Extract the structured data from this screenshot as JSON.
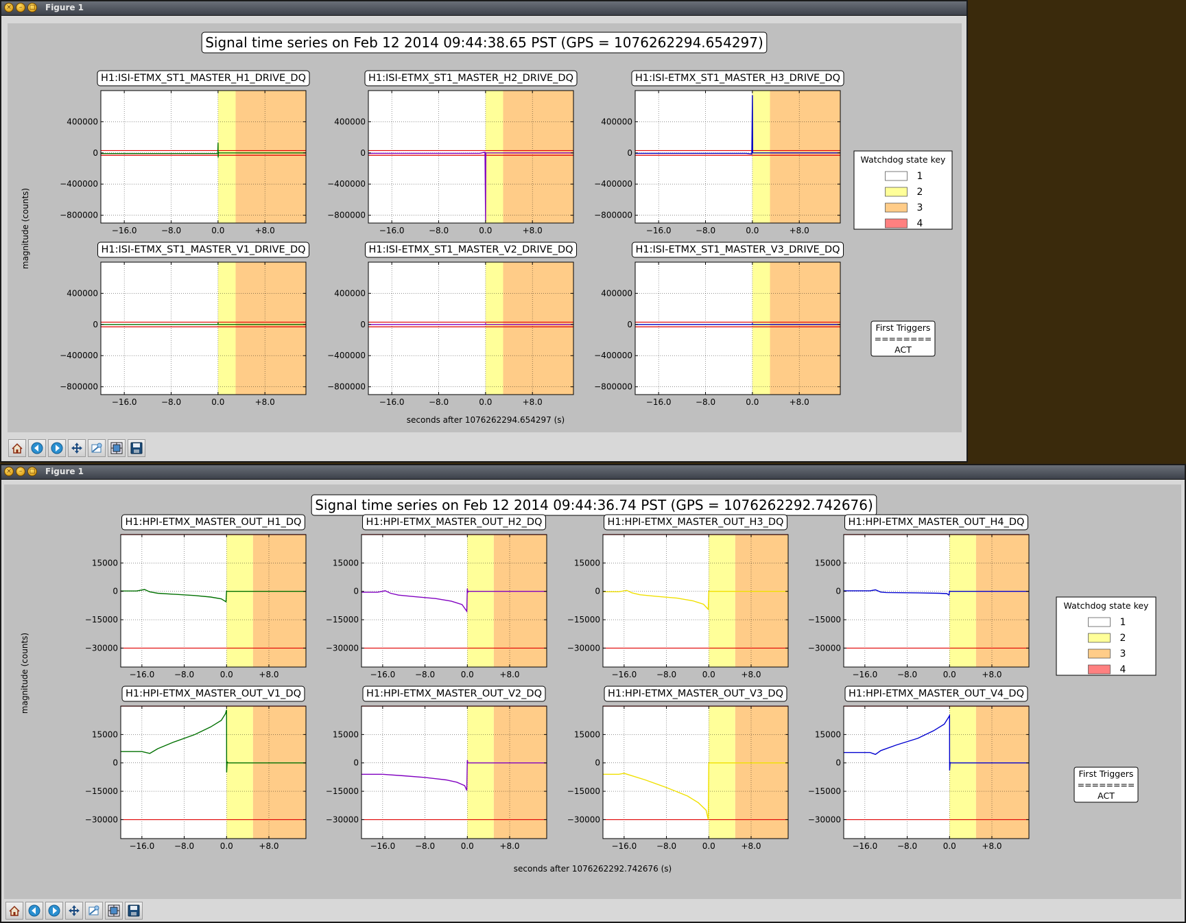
{
  "windows": [
    {
      "title": "Figure 1",
      "figure": {
        "title": "Signal time series on Feb 12 2014 09:44:38.65 PST (GPS = 1076262294.654297)",
        "xlabel": "seconds after 1076262294.654297 (s)",
        "ylabel": "magnitude (counts)",
        "legend": {
          "title": "Watchdog state key",
          "entries": [
            {
              "label": "1",
              "color": "#ffffff"
            },
            {
              "label": "2",
              "color": "#ffff99"
            },
            {
              "label": "3",
              "color": "#ffcc88"
            },
            {
              "label": "4",
              "color": "#ff8080"
            }
          ]
        },
        "triggers": {
          "header": "First Triggers",
          "rule": "========",
          "value": "ACT"
        }
      }
    },
    {
      "title": "Figure 1",
      "figure": {
        "title": "Signal time series on Feb 12 2014 09:44:36.74 PST (GPS = 1076262292.742676)",
        "xlabel": "seconds after 1076262292.742676 (s)",
        "ylabel": "magnitude (counts)",
        "legend": {
          "title": "Watchdog state key",
          "entries": [
            {
              "label": "1",
              "color": "#ffffff"
            },
            {
              "label": "2",
              "color": "#ffff99"
            },
            {
              "label": "3",
              "color": "#ffcc88"
            },
            {
              "label": "4",
              "color": "#ff8080"
            }
          ]
        },
        "triggers": {
          "header": "First Triggers",
          "rule": "========",
          "value": "ACT"
        }
      }
    }
  ],
  "toolbar_icons": [
    "home-icon",
    "back-icon",
    "forward-icon",
    "pan-icon",
    "zoom-icon",
    "configure-subplots-icon",
    "save-icon"
  ],
  "chart_data": [
    {
      "type": "line",
      "title": "Signal time series on Feb 12 2014 09:44:38.65 PST (GPS = 1076262294.654297)",
      "xlabel": "seconds after 1076262294.654297 (s)",
      "ylabel": "magnitude (counts)",
      "xlim": [
        -20,
        15
      ],
      "ylim": [
        -900000,
        800000
      ],
      "xticks": [
        -16,
        -8,
        0,
        8
      ],
      "xtick_labels": [
        "−16.0",
        "−8.0",
        "0.0",
        "+8.0"
      ],
      "yticks": [
        400000,
        0,
        -400000,
        -800000
      ],
      "ytick_labels": [
        "400000",
        "0",
        "−400000",
        "−800000"
      ],
      "grid": true,
      "state_bands": [
        {
          "state": "2",
          "from": 0,
          "to": 3,
          "color": "#ffff99"
        },
        {
          "state": "3",
          "from": 3,
          "to": 15,
          "color": "#ffcc88"
        }
      ],
      "threshold_lines": [
        {
          "y": 30000,
          "color": "#e00000"
        },
        {
          "y": -30000,
          "color": "#e00000"
        }
      ],
      "subplots": [
        {
          "title": "H1:ISI-ETMX_ST1_MASTER_H1_DRIVE_DQ",
          "color": "#007000",
          "series": {
            "x": [
              -20,
              -0.05,
              0,
              0.02,
              0.06,
              0.15,
              15
            ],
            "y": [
              -8000,
              -8000,
              130000,
              -60000,
              10000,
              0,
              0
            ]
          }
        },
        {
          "title": "H1:ISI-ETMX_ST1_MASTER_H2_DRIVE_DQ",
          "color": "#8000c0",
          "series": {
            "x": [
              -20,
              -1,
              -0.1,
              0,
              0.05,
              0.15,
              15
            ],
            "y": [
              -5000,
              -5000,
              10000,
              -880000,
              0,
              0,
              0
            ]
          }
        },
        {
          "title": "H1:ISI-ETMX_ST1_MASTER_H3_DRIVE_DQ",
          "color": "#0000c0",
          "series": {
            "x": [
              -20,
              -1,
              -0.1,
              0,
              0.05,
              0.15,
              15
            ],
            "y": [
              -5000,
              -5000,
              -15000,
              740000,
              0,
              0,
              0
            ]
          }
        },
        {
          "title": "H1:ISI-ETMX_ST1_MASTER_V1_DRIVE_DQ",
          "color": "#007000",
          "series": {
            "x": [
              -20,
              -0.05,
              0,
              0.05,
              15
            ],
            "y": [
              0,
              0,
              15000,
              0,
              0
            ]
          }
        },
        {
          "title": "H1:ISI-ETMX_ST1_MASTER_V2_DRIVE_DQ",
          "color": "#8000c0",
          "series": {
            "x": [
              -20,
              -0.05,
              0,
              0.05,
              15
            ],
            "y": [
              0,
              0,
              10000,
              0,
              0
            ]
          }
        },
        {
          "title": "H1:ISI-ETMX_ST1_MASTER_V3_DRIVE_DQ",
          "color": "#0000c0",
          "series": {
            "x": [
              -20,
              -0.05,
              0,
              0.05,
              15
            ],
            "y": [
              0,
              0,
              10000,
              0,
              0
            ]
          }
        }
      ]
    },
    {
      "type": "line",
      "title": "Signal time series on Feb 12 2014 09:44:36.74 PST (GPS = 1076262292.742676)",
      "xlabel": "seconds after 1076262292.742676 (s)",
      "ylabel": "magnitude (counts)",
      "xlim": [
        -20,
        15
      ],
      "ylim": [
        -40000,
        30000
      ],
      "xticks": [
        -16,
        -8,
        0,
        8
      ],
      "xtick_labels": [
        "−16.0",
        "−8.0",
        "0.0",
        "+8.0"
      ],
      "yticks": [
        15000,
        0,
        -15000,
        -30000
      ],
      "ytick_labels": [
        "15000",
        "0",
        "−15000",
        "−30000"
      ],
      "grid": true,
      "state_bands": [
        {
          "state": "2",
          "from": 0,
          "to": 5,
          "color": "#ffff99"
        },
        {
          "state": "3",
          "from": 5,
          "to": 15,
          "color": "#ffcc88"
        }
      ],
      "threshold_lines": [
        {
          "y": -30000,
          "color": "#e00000"
        },
        {
          "y": 30000,
          "color": "#e00000"
        }
      ],
      "subplots": [
        {
          "title": "H1:HPI-ETMX_MASTER_OUT_H1_DQ",
          "color": "#007000",
          "series": {
            "x": [
              -20,
              -17,
              -15.5,
              -14.5,
              -13,
              -10,
              -6,
              -3,
              -1,
              -0.1,
              0,
              0.1,
              15
            ],
            "y": [
              200,
              200,
              1000,
              -300,
              -1000,
              -1500,
              -2200,
              -3000,
              -4000,
              -5500,
              0,
              0,
              0
            ]
          }
        },
        {
          "title": "H1:HPI-ETMX_MASTER_OUT_H2_DQ",
          "color": "#8000c0",
          "series": {
            "x": [
              -20,
              -17,
              -15.5,
              -14.5,
              -13,
              -10,
              -6,
              -3,
              -1,
              -0.1,
              0,
              0.08,
              0.2,
              15
            ],
            "y": [
              -500,
              -500,
              300,
              -1000,
              -2000,
              -2800,
              -3800,
              -5200,
              -7000,
              -10500,
              1500,
              -500,
              0,
              0
            ]
          }
        },
        {
          "title": "H1:HPI-ETMX_MASTER_OUT_H3_DQ",
          "color": "#f0e000",
          "series": {
            "x": [
              -20,
              -17,
              -15.5,
              -14.5,
              -13,
              -10,
              -6,
              -3,
              -1,
              -0.1,
              0,
              0.1,
              15
            ],
            "y": [
              -200,
              -200,
              500,
              -800,
              -1800,
              -2600,
              -3600,
              -5000,
              -6800,
              -9500,
              0,
              0,
              0
            ]
          }
        },
        {
          "title": "H1:HPI-ETMX_MASTER_OUT_H4_DQ",
          "color": "#0000d0",
          "series": {
            "x": [
              -20,
              -15,
              -14,
              -13,
              -12,
              -6,
              -2,
              -0.5,
              -0.1,
              0,
              0.1,
              15
            ],
            "y": [
              300,
              300,
              800,
              -400,
              -600,
              -800,
              -1000,
              -1200,
              -2000,
              0,
              0,
              0
            ]
          }
        },
        {
          "title": "H1:HPI-ETMX_MASTER_OUT_V1_DQ",
          "color": "#007000",
          "series": {
            "x": [
              -20,
              -16,
              -14.5,
              -13,
              -10,
              -6,
              -3,
              -1,
              -0.2,
              0,
              0.02,
              0.1,
              0.3,
              15
            ],
            "y": [
              6000,
              6000,
              5000,
              7500,
              11000,
              15000,
              19000,
              22500,
              26000,
              28000,
              -5000,
              500,
              0,
              0
            ]
          }
        },
        {
          "title": "H1:HPI-ETMX_MASTER_OUT_V2_DQ",
          "color": "#8000c0",
          "series": {
            "x": [
              -20,
              -16,
              -12,
              -8,
              -4,
              -2,
              -0.5,
              -0.1,
              0,
              0.1,
              15
            ],
            "y": [
              -6000,
              -6000,
              -6800,
              -7700,
              -9000,
              -10200,
              -12000,
              -14500,
              1500,
              0,
              0
            ]
          }
        },
        {
          "title": "H1:HPI-ETMX_MASTER_OUT_V3_DQ",
          "color": "#f0e000",
          "series": {
            "x": [
              -20,
              -17,
              -16,
              -12,
              -8,
              -4,
              -2,
              -0.5,
              -0.1,
              0,
              15
            ],
            "y": [
              -6000,
              -6000,
              -5500,
              -9000,
              -13000,
              -17500,
              -21000,
              -25000,
              -30000,
              0,
              0
            ]
          }
        },
        {
          "title": "H1:HPI-ETMX_MASTER_OUT_V4_DQ",
          "color": "#0000d0",
          "series": {
            "x": [
              -20,
              -15,
              -14,
              -13,
              -10,
              -6,
              -3,
              -1,
              -0.2,
              0,
              0.02,
              0.1,
              0.3,
              15
            ],
            "y": [
              5500,
              5500,
              4500,
              6500,
              9500,
              13000,
              17000,
              20500,
              24000,
              25000,
              -4000,
              200,
              0,
              0
            ]
          }
        }
      ]
    }
  ]
}
